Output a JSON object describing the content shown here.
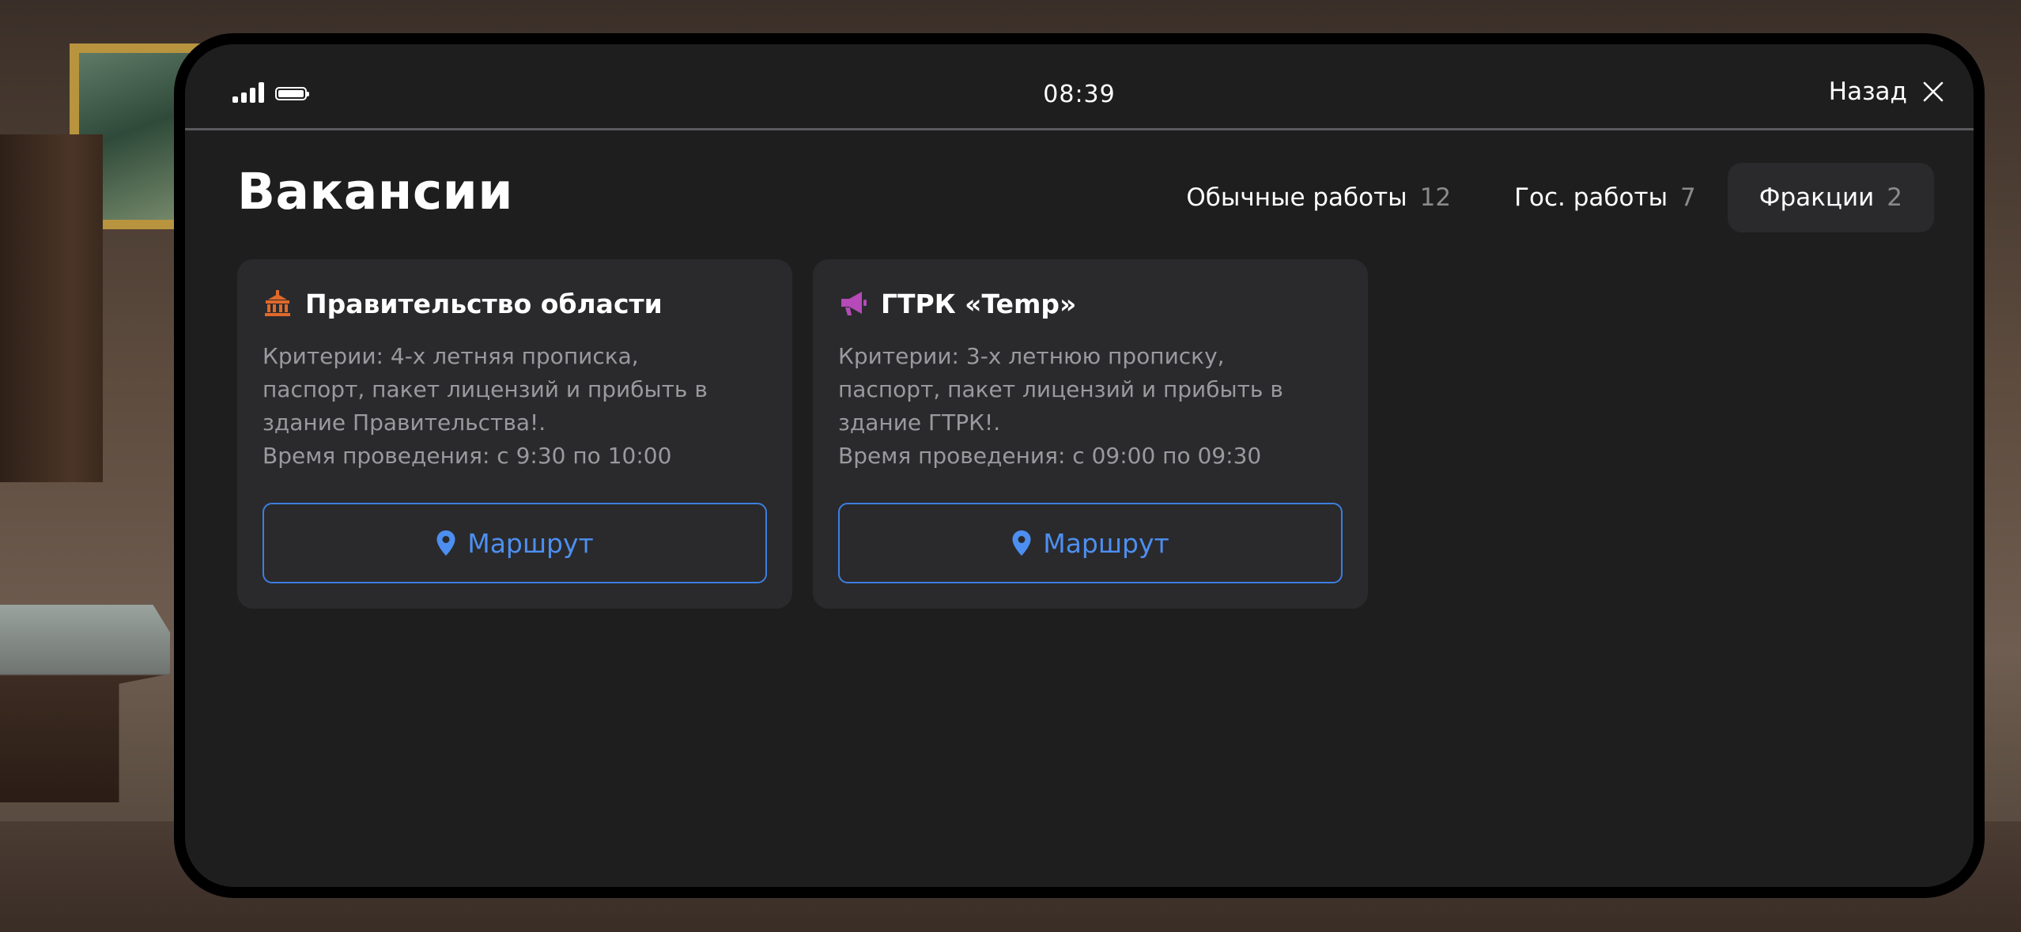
{
  "status_bar": {
    "time": "08:39",
    "back_label": "Назад"
  },
  "page": {
    "title": "Вакансии"
  },
  "tabs": [
    {
      "label": "Обычные работы",
      "count": "12",
      "active": false
    },
    {
      "label": "Гос. работы",
      "count": "7",
      "active": false
    },
    {
      "label": "Фракции",
      "count": "2",
      "active": true
    }
  ],
  "cards": [
    {
      "icon": "government-building-icon",
      "icon_color": "#e0692a",
      "title": "Правительство области",
      "criteria_lines": [
        "Критерии: 4-х летняя прописка,",
        "паспорт, пакет лицензий и прибыть в",
        "здание Правительства!.",
        "Время проведения: с 9:30 по 10:00"
      ],
      "button_label": "Маршрут"
    },
    {
      "icon": "megaphone-icon",
      "icon_color": "#b54ab8",
      "title": "ГТРК «Temp»",
      "criteria_lines": [
        "Критерии: 3-х летнюю прописку,",
        "паспорт, пакет лицензий и прибыть в",
        "здание ГТРК!.",
        "Время проведения: с 09:00 по 09:30"
      ],
      "button_label": "Маршрут"
    }
  ],
  "colors": {
    "accent": "#4d8ff0",
    "panel": "#1e1e1f",
    "card": "#2a2a2c"
  }
}
